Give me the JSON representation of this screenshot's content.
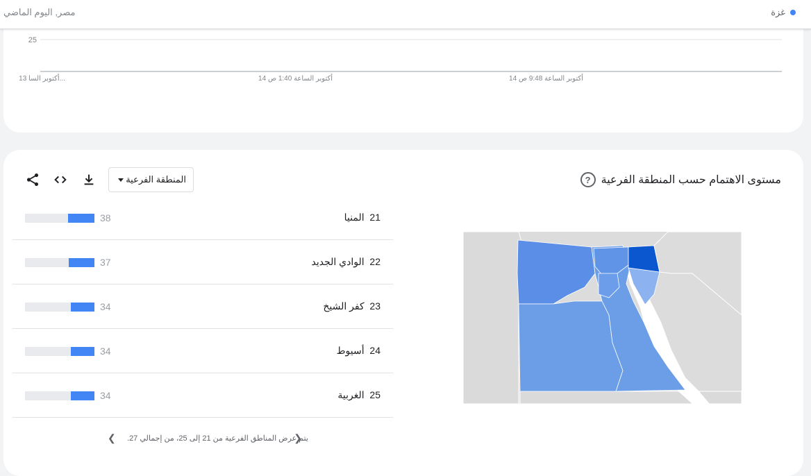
{
  "topbar": {
    "term": "غزة",
    "meta": "مصر, اليوم الماضي"
  },
  "timeline": {
    "y_tick": "25",
    "x_ticks": [
      "13 أكتوبر السا...",
      "14 أكتوبر الساعة 1:40 ص",
      "14 أكتوبر الساعة 9:48 ص"
    ]
  },
  "region": {
    "title": "مستوى الاهتمام حسب المنطقة الفرعية",
    "help_icon": "help-circle-icon",
    "dropdown_label": "المنطقة الفرعية",
    "tools": [
      "download-icon",
      "embed-code-icon",
      "share-icon"
    ],
    "rows": [
      {
        "rank": "21",
        "name": "المنيا",
        "value": "38",
        "level": 38
      },
      {
        "rank": "22",
        "name": "الوادي الجديد",
        "value": "37",
        "level": 37
      },
      {
        "rank": "23",
        "name": "كفر الشيخ",
        "value": "34",
        "level": 34
      },
      {
        "rank": "24",
        "name": "أسيوط",
        "value": "34",
        "level": 34
      },
      {
        "rank": "25",
        "name": "الغربية",
        "value": "34",
        "level": 34
      }
    ],
    "pager_text": "يتم عرض المناطق الفرعية من 21 إلى 25، من إجمالي 27.",
    "colors": {
      "accent": "#4285f4",
      "highlight": "#0b57d0",
      "map_base": "#6c9ee8",
      "neighbor": "#dcdcdc"
    }
  }
}
